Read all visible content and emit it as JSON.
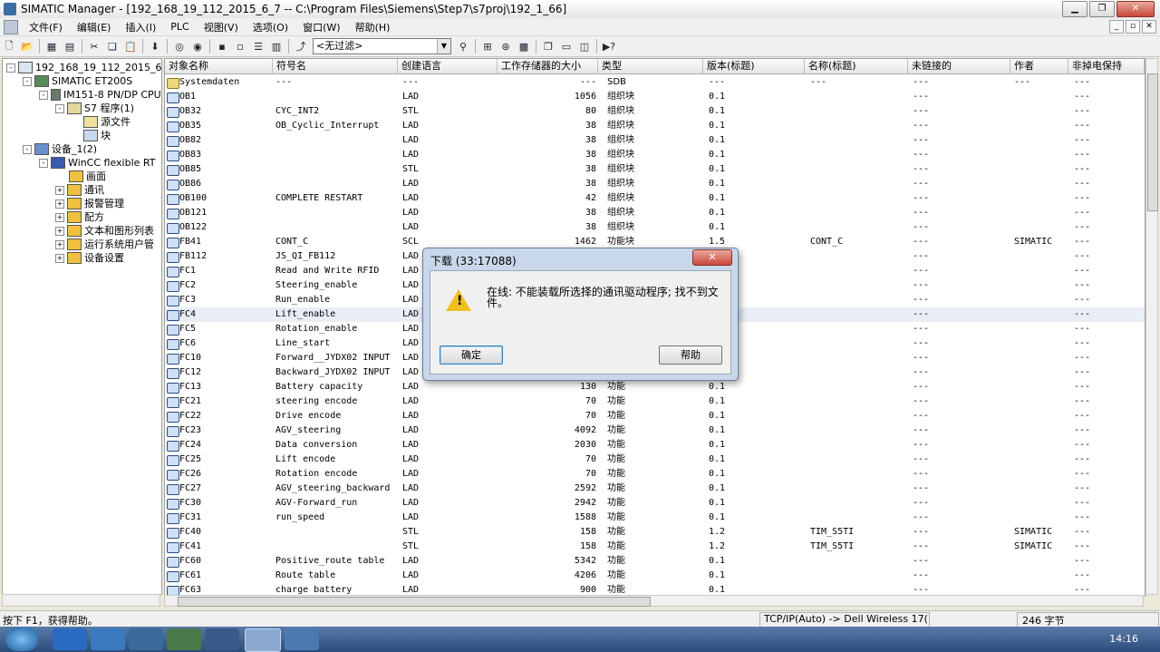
{
  "window": {
    "title": "SIMATIC Manager - [192_168_19_112_2015_6_7 -- C:\\Program Files\\Siemens\\Step7\\s7proj\\192_1_66]"
  },
  "menu": [
    "文件(F)",
    "编辑(E)",
    "插入(I)",
    "PLC",
    "视图(V)",
    "选项(O)",
    "窗口(W)",
    "帮助(H)"
  ],
  "toolbar": {
    "filter_value": "<无过滤>"
  },
  "tree": [
    {
      "label": "192_168_19_112_2015_6_7",
      "exp": "-"
    },
    {
      "label": "SIMATIC ET200S",
      "exp": "-"
    },
    {
      "label": "IM151-8 PN/DP CPU",
      "exp": "-"
    },
    {
      "label": "S7 程序(1)",
      "exp": "-"
    },
    {
      "label": "源文件",
      "exp": ""
    },
    {
      "label": "块",
      "exp": ""
    },
    {
      "label": "设备_1(2)",
      "exp": "-"
    },
    {
      "label": "WinCC flexible RT",
      "exp": "-"
    },
    {
      "label": "画面",
      "exp": ""
    },
    {
      "label": "通讯",
      "exp": "+"
    },
    {
      "label": "报警管理",
      "exp": "+"
    },
    {
      "label": "配方",
      "exp": "+"
    },
    {
      "label": "文本和图形列表",
      "exp": "+"
    },
    {
      "label": "运行系统用户管",
      "exp": "+"
    },
    {
      "label": "设备设置",
      "exp": "+"
    }
  ],
  "columns": [
    "对象名称",
    "符号名",
    "创建语言",
    "工作存储器的大小",
    "类型",
    "版本(标题)",
    "名称(标题)",
    "未链接的",
    "作者",
    "非掉电保持"
  ],
  "rows": [
    [
      "Systemdaten",
      "---",
      "---",
      "---",
      "SDB",
      "---",
      "---",
      "---",
      "---",
      "---"
    ],
    [
      "OB1",
      "",
      "LAD",
      "1056",
      "组织块",
      "0.1",
      "",
      "---",
      "",
      "---"
    ],
    [
      "OB32",
      "CYC_INT2",
      "STL",
      "80",
      "组织块",
      "0.1",
      "",
      "---",
      "",
      "---"
    ],
    [
      "OB35",
      "OB_Cyclic_Interrupt",
      "LAD",
      "38",
      "组织块",
      "0.1",
      "",
      "---",
      "",
      "---"
    ],
    [
      "OB82",
      "",
      "LAD",
      "38",
      "组织块",
      "0.1",
      "",
      "---",
      "",
      "---"
    ],
    [
      "OB83",
      "",
      "LAD",
      "38",
      "组织块",
      "0.1",
      "",
      "---",
      "",
      "---"
    ],
    [
      "OB85",
      "",
      "STL",
      "38",
      "组织块",
      "0.1",
      "",
      "---",
      "",
      "---"
    ],
    [
      "OB86",
      "",
      "LAD",
      "38",
      "组织块",
      "0.1",
      "",
      "---",
      "",
      "---"
    ],
    [
      "OB100",
      "COMPLETE RESTART",
      "LAD",
      "42",
      "组织块",
      "0.1",
      "",
      "---",
      "",
      "---"
    ],
    [
      "OB121",
      "",
      "LAD",
      "38",
      "组织块",
      "0.1",
      "",
      "---",
      "",
      "---"
    ],
    [
      "OB122",
      "",
      "LAD",
      "38",
      "组织块",
      "0.1",
      "",
      "---",
      "",
      "---"
    ],
    [
      "FB41",
      "CONT_C",
      "SCL",
      "1462",
      "功能块",
      "1.5",
      "CONT_C",
      "---",
      "SIMATIC",
      "---"
    ],
    [
      "FB112",
      "JS_QI_FB112",
      "LAD",
      "",
      "",
      "",
      "",
      "---",
      "",
      "---"
    ],
    [
      "FC1",
      "Read and Write RFID",
      "LAD",
      "",
      "",
      "",
      "",
      "---",
      "",
      "---"
    ],
    [
      "FC2",
      "Steering_enable",
      "LAD",
      "",
      "",
      "",
      "",
      "---",
      "",
      "---"
    ],
    [
      "FC3",
      "Run_enable",
      "LAD",
      "",
      "",
      "",
      "",
      "---",
      "",
      "---"
    ],
    [
      "FC4",
      "Lift_enable",
      "LAD",
      "",
      "",
      "",
      "",
      "---",
      "",
      "---"
    ],
    [
      "FC5",
      "Rotation_enable",
      "LAD",
      "",
      "",
      "",
      "",
      "---",
      "",
      "---"
    ],
    [
      "FC6",
      "Line_start",
      "LAD",
      "",
      "",
      "",
      "",
      "---",
      "",
      "---"
    ],
    [
      "FC10",
      "Forward__JYDX02 INPUT",
      "LAD",
      "",
      "",
      "",
      "",
      "---",
      "",
      "---"
    ],
    [
      "FC12",
      "Backward_JYDX02 INPUT",
      "LAD",
      "",
      "",
      "",
      "",
      "---",
      "",
      "---"
    ],
    [
      "FC13",
      "Battery capacity",
      "LAD",
      "130",
      "功能",
      "0.1",
      "",
      "---",
      "",
      "---"
    ],
    [
      "FC21",
      "steering encode",
      "LAD",
      "70",
      "功能",
      "0.1",
      "",
      "---",
      "",
      "---"
    ],
    [
      "FC22",
      "Drive encode",
      "LAD",
      "70",
      "功能",
      "0.1",
      "",
      "---",
      "",
      "---"
    ],
    [
      "FC23",
      "AGV_steering",
      "LAD",
      "4092",
      "功能",
      "0.1",
      "",
      "---",
      "",
      "---"
    ],
    [
      "FC24",
      "Data conversion",
      "LAD",
      "2030",
      "功能",
      "0.1",
      "",
      "---",
      "",
      "---"
    ],
    [
      "FC25",
      "Lift encode",
      "LAD",
      "70",
      "功能",
      "0.1",
      "",
      "---",
      "",
      "---"
    ],
    [
      "FC26",
      "Rotation encode",
      "LAD",
      "70",
      "功能",
      "0.1",
      "",
      "---",
      "",
      "---"
    ],
    [
      "FC27",
      "AGV_steering_backward",
      "LAD",
      "2592",
      "功能",
      "0.1",
      "",
      "---",
      "",
      "---"
    ],
    [
      "FC30",
      "AGV-Forward_run",
      "LAD",
      "2942",
      "功能",
      "0.1",
      "",
      "---",
      "",
      "---"
    ],
    [
      "FC31",
      "run_speed",
      "LAD",
      "1588",
      "功能",
      "0.1",
      "",
      "---",
      "",
      "---"
    ],
    [
      "FC40",
      "",
      "STL",
      "158",
      "功能",
      "1.2",
      "TIM_S5TI",
      "---",
      "SIMATIC",
      "---"
    ],
    [
      "FC41",
      "",
      "STL",
      "158",
      "功能",
      "1.2",
      "TIM_S5TI",
      "---",
      "SIMATIC",
      "---"
    ],
    [
      "FC60",
      "Positive_route table",
      "LAD",
      "5342",
      "功能",
      "0.1",
      "",
      "---",
      "",
      "---"
    ],
    [
      "FC61",
      "Route table",
      "LAD",
      "4206",
      "功能",
      "0.1",
      "",
      "---",
      "",
      "---"
    ],
    [
      "FC63",
      "charge battery",
      "LAD",
      "900",
      "功能",
      "0.1",
      "",
      "---",
      "",
      "---"
    ]
  ],
  "dialog": {
    "title": "下载 (33:17088)",
    "close": "✕",
    "message": "在线: 不能装载所选择的通讯驱动程序; 找不到文件。",
    "ok": "确定",
    "help": "帮助"
  },
  "status": {
    "hint": "按下 F1，获得帮助。",
    "interface": "TCP/IP(Auto) -> Dell Wireless 17(",
    "size": "246 字节"
  },
  "taskbar": {
    "clock": "14:16"
  }
}
